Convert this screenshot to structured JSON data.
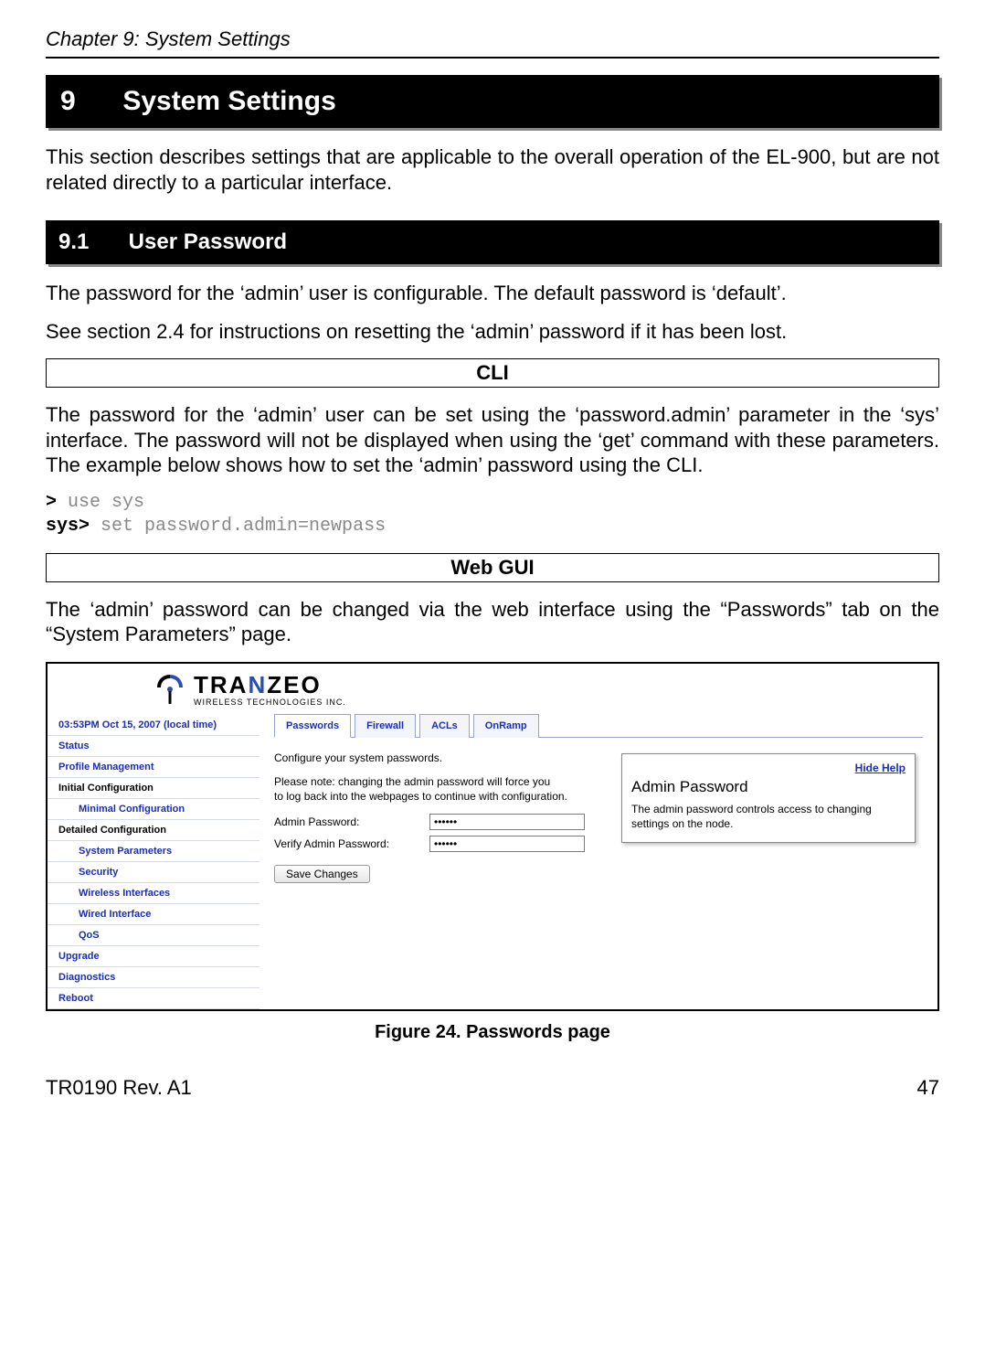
{
  "header": {
    "running": "Chapter 9: System Settings"
  },
  "h1": {
    "num": "9",
    "title": "System Settings"
  },
  "intro": "This section describes settings that are applicable to the overall operation of the EL-900, but are not related directly to a particular interface.",
  "h2": {
    "num": "9.1",
    "title": "User Password"
  },
  "p1": "The password for the ‘admin’ user is configurable. The default password is ‘default’.",
  "p2": "See section 2.4 for instructions on resetting the ‘admin’ password if it has been lost.",
  "cli_label": "CLI",
  "cli_text": "The password for the ‘admin’ user can be set using the ‘password.admin’ parameter in the ‘sys’ interface. The password will not be displayed when using the ‘get’ command with these parameters. The example below shows how to set the ‘admin’ password using the CLI.",
  "cli": {
    "prompt1": ">",
    "cmd1": " use sys",
    "prompt2": "sys>",
    "cmd2": " set password.admin=newpass"
  },
  "webgui_label": "Web GUI",
  "webgui_text": "The ‘admin’ password can be changed via the web interface using the “Passwords” tab on the “System Parameters” page.",
  "logo": {
    "pre": "TRA",
    "mid": "N",
    "post": "ZEO",
    "sub": "WIRELESS  TECHNOLOGIES INC."
  },
  "sidebar": {
    "time": "03:53PM Oct 15, 2007 (local time)",
    "items": {
      "status": "Status",
      "profile": "Profile Management",
      "init_cfg": "Initial Configuration",
      "min_cfg": "Minimal Configuration",
      "det_cfg": "Detailed Configuration",
      "sys_params": "System Parameters",
      "security": "Security",
      "wireless": "Wireless Interfaces",
      "wired": "Wired Interface",
      "qos": "QoS",
      "upgrade": "Upgrade",
      "diagnostics": "Diagnostics",
      "reboot": "Reboot"
    }
  },
  "tabs": {
    "passwords": "Passwords",
    "firewall": "Firewall",
    "acls": "ACLs",
    "onramp": "OnRamp"
  },
  "form": {
    "intro": "Configure your system passwords.",
    "note1": "Please note: changing the admin password will force you",
    "note2": "to log back into the webpages to continue with configuration.",
    "admin_label": "Admin Password:",
    "verify_label": "Verify Admin Password:",
    "admin_value": "••••••",
    "verify_value": "••••••",
    "save": "Save Changes"
  },
  "help": {
    "hide": "Hide Help",
    "title": "Admin Password",
    "desc": "The admin password controls access to changing settings on the node."
  },
  "caption": "Figure 24. Passwords page",
  "footer": {
    "left": "TR0190 Rev. A1",
    "right": "47"
  }
}
